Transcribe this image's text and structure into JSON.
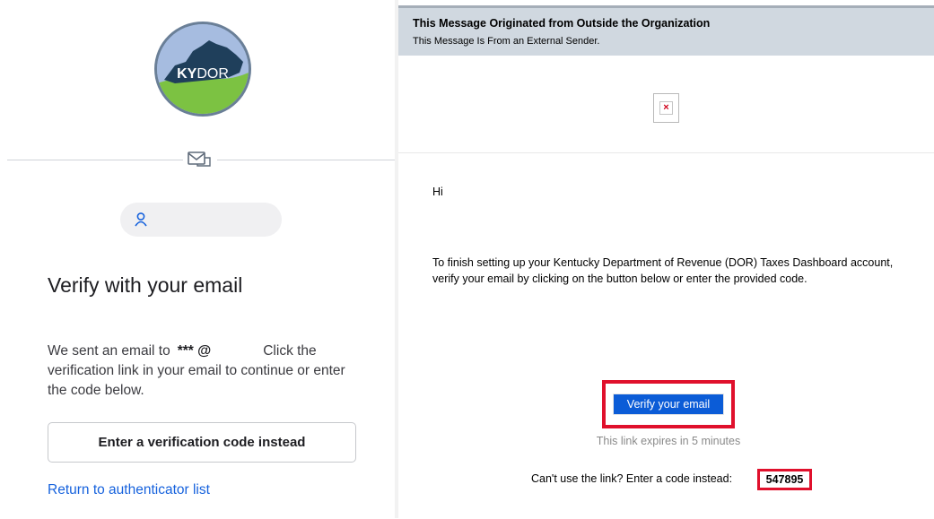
{
  "login": {
    "logo_text_ky": "KY",
    "logo_text_dor": "DOR",
    "title": "Verify with your email",
    "desc_part1": "We sent an email to",
    "masked_email": "*** @",
    "desc_part2": "Click the verification link in your email to continue or enter the code below.",
    "code_button_label": "Enter a verification code instead",
    "return_link": "Return to authenticator list"
  },
  "email": {
    "banner_title": "This Message Originated from Outside the Organization",
    "banner_subtitle": "This Message Is From an External Sender.",
    "greeting": "Hi",
    "paragraph": "To finish setting up your Kentucky Department of Revenue (DOR) Taxes Dashboard account, verify your email by clicking on the button below or enter the provided code.",
    "verify_button": "Verify your email",
    "expires_text": "This link expires in 5 minutes",
    "code_prompt": "Can't use the link? Enter a code instead:",
    "code": "547895"
  },
  "colors": {
    "highlight_red": "#e0102c",
    "link_blue": "#1662dd",
    "button_blue": "#0b5cd7",
    "banner_gray": "#d0d8e0"
  },
  "icons": {
    "divider": "envelope-icon",
    "identifier": "user-icon",
    "broken_image": "broken-image-icon"
  }
}
